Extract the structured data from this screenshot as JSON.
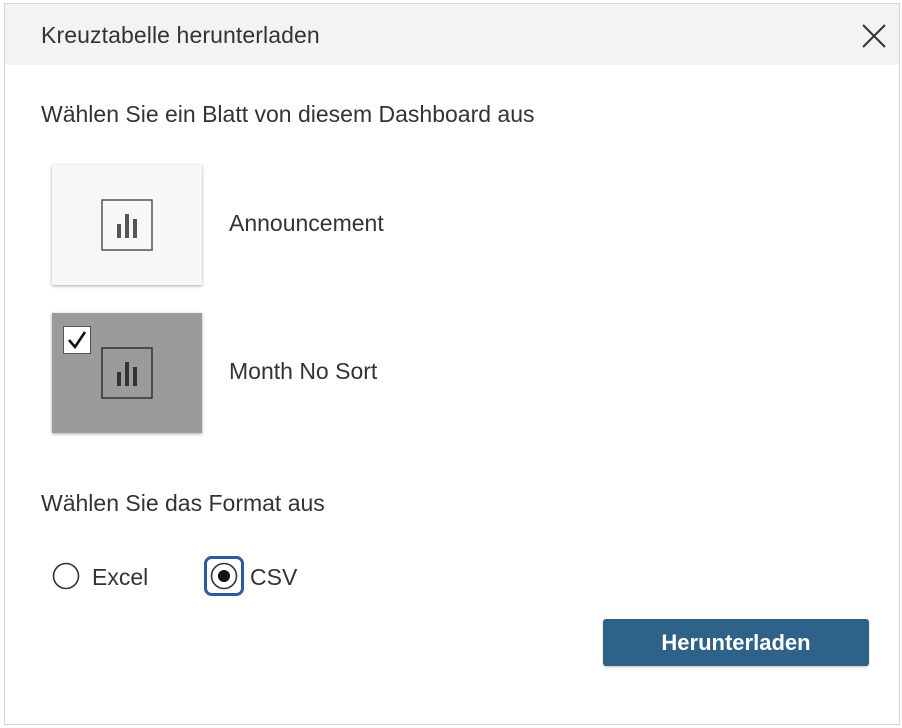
{
  "dialog": {
    "title": "Kreuztabelle herunterladen"
  },
  "sheets": {
    "prompt": "Wählen Sie ein Blatt von diesem Dashboard aus",
    "items": [
      {
        "label": "Announcement",
        "selected": false,
        "icon": "bar-chart-icon"
      },
      {
        "label": "Month No Sort",
        "selected": true,
        "icon": "bar-chart-icon"
      }
    ]
  },
  "format": {
    "prompt": "Wählen Sie das Format aus",
    "options": [
      {
        "label": "Excel",
        "selected": false
      },
      {
        "label": "CSV",
        "selected": true
      }
    ]
  },
  "actions": {
    "download_label": "Herunterladen"
  },
  "colors": {
    "header_bg": "#f3f3f3",
    "selected_thumb": "#9b9b9b",
    "primary_button": "#2e6289",
    "focus_ring": "#2e5a9c"
  }
}
